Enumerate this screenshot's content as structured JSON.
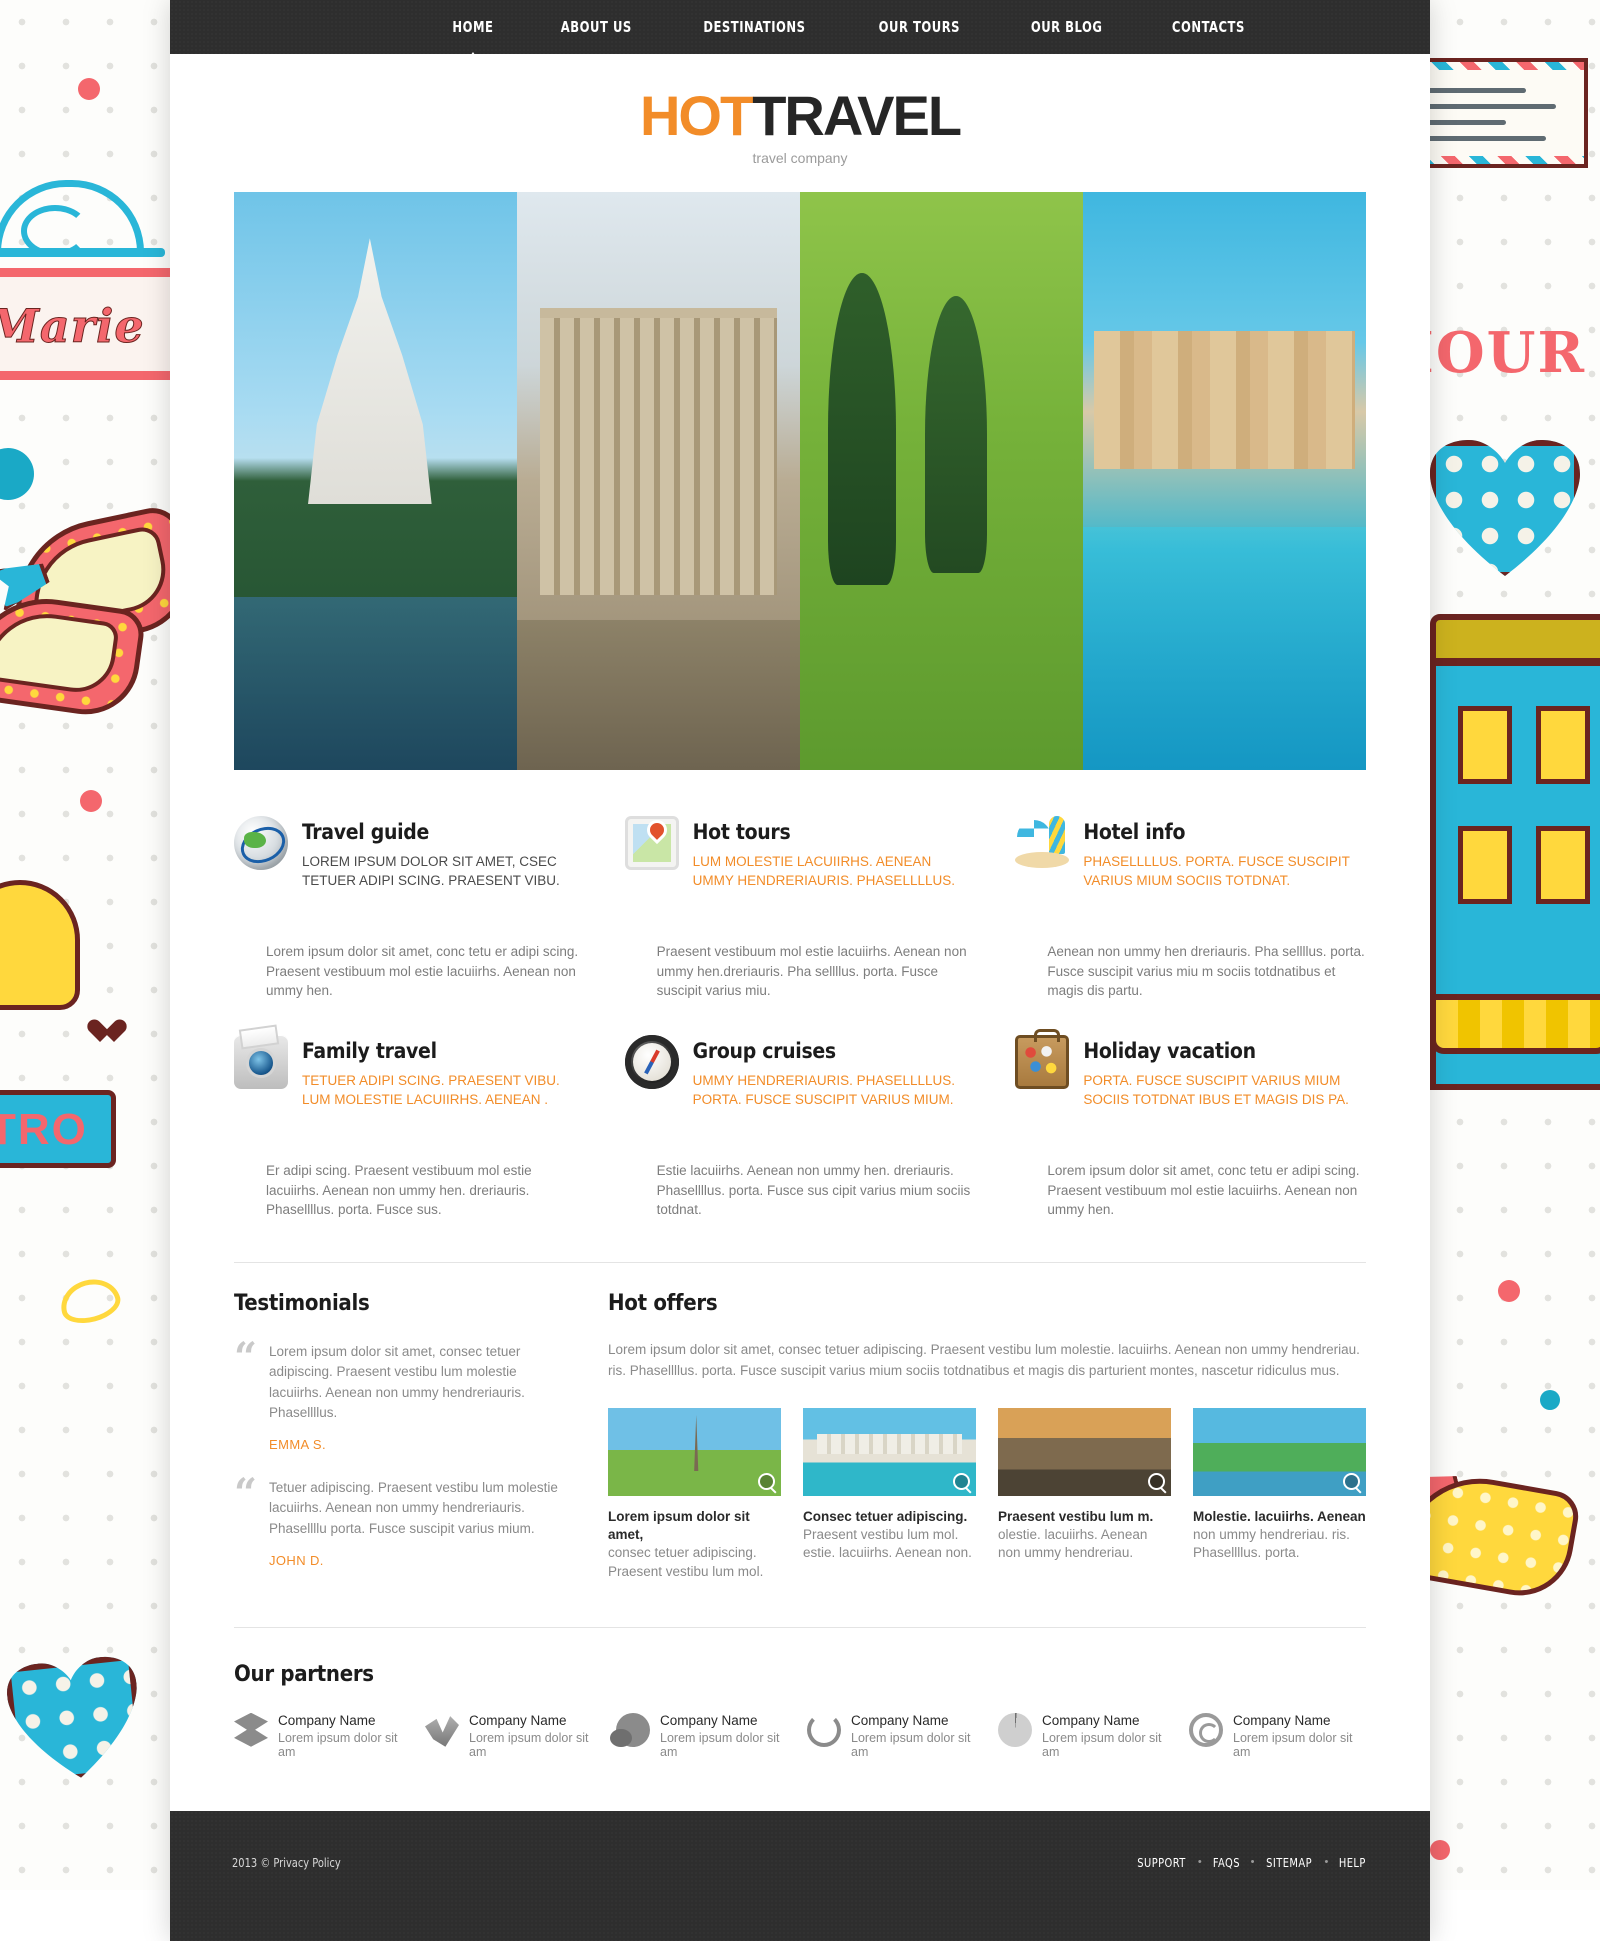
{
  "nav": {
    "items": [
      {
        "label": "HOME",
        "active": true
      },
      {
        "label": "ABOUT US",
        "active": false
      },
      {
        "label": "DESTINATIONS",
        "active": false
      },
      {
        "label": "OUR TOURS",
        "active": false
      },
      {
        "label": "OUR BLOG",
        "active": false
      },
      {
        "label": "CONTACTS",
        "active": false
      }
    ]
  },
  "logo": {
    "part1": "HOT",
    "part2": "TRAVEL",
    "tagline": "travel company",
    "accent_color": "#f28c28",
    "dark_color": "#262626"
  },
  "hero": {
    "panes": [
      {
        "alt": "thai-temple"
      },
      {
        "alt": "roman-ruins"
      },
      {
        "alt": "green-garden"
      },
      {
        "alt": "venice-canal"
      }
    ]
  },
  "services": [
    {
      "icon": "globe-icon",
      "title": "Travel guide",
      "subtitle": "LOREM IPSUM DOLOR SIT AMET, CSEC TETUER ADIPI SCING. PRAESENT VIBU.",
      "subtitle_orange": false,
      "text": "Lorem ipsum dolor sit amet, conc tetu er adipi scing. Praesent vestibuum mol estie lacuiirhs. Aenean non ummy hen."
    },
    {
      "icon": "map-pin-icon",
      "title": "Hot tours",
      "subtitle": "LUM MOLESTIE LACUIIRHS. AENEAN UMMY HENDRERIAURIS. PHASELLLLUS.",
      "subtitle_orange": true,
      "text": "Praesent vestibuum mol estie lacuiirhs. Aenean non ummy hen.dreriauris. Pha sellllus. porta. Fusce suscipit varius miu."
    },
    {
      "icon": "beach-umbrella-icon",
      "title": "Hotel info",
      "subtitle": "PHASELLLLUS. PORTA. FUSCE SUSCIPIT VARIUS MIUM SOCIIS TOTDNAT.",
      "subtitle_orange": true,
      "text": "Aenean non ummy hen dreriauris. Pha sellllus. porta. Fusce suscipit varius miu m sociis totdnatibus  et magis dis partu."
    },
    {
      "icon": "camera-icon",
      "title": "Family travel",
      "subtitle": "TETUER ADIPI SCING. PRAESENT VIBU. LUM MOLESTIE LACUIIRHS. AENEAN .",
      "subtitle_orange": true,
      "text": "Er adipi scing. Praesent vestibuum mol estie lacuiirhs. Aenean non ummy hen. dreriauris. Phasellllus. porta. Fusce sus."
    },
    {
      "icon": "compass-icon",
      "title": "Group cruises",
      "subtitle": "UMMY HENDRERIAURIS. PHASELLLLUS. PORTA. FUSCE SUSCIPIT VARIUS MIUM.",
      "subtitle_orange": true,
      "text": "Estie lacuiirhs. Aenean non ummy hen. dreriauris. Phasellllus. porta. Fusce sus cipit varius mium sociis totdnat."
    },
    {
      "icon": "suitcase-icon",
      "title": "Holiday vacation",
      "subtitle": "PORTA. FUSCE SUSCIPIT VARIUS MIUM SOCIIS TOTDNAT IBUS ET MAGIS DIS PA.",
      "subtitle_orange": true,
      "text": "Lorem ipsum dolor sit amet, conc tetu er adipi scing. Praesent vestibuum mol estie lacuiirhs. Aenean non ummy hen."
    }
  ],
  "testimonials": {
    "title": "Testimonials",
    "items": [
      {
        "text": "Lorem ipsum dolor sit amet, consec tetuer adipiscing. Praesent vestibu lum molestie lacuiirhs. Aenean non ummy  hendreriauris. Phasellllus.",
        "author": "EMMA S."
      },
      {
        "text": "Tetuer adipiscing. Praesent vestibu lum molestie lacuiirhs. Aenean non ummy  hendreriauris. Phasellllu porta. Fusce suscipit varius mium.",
        "author": "JOHN D."
      }
    ]
  },
  "hot_offers": {
    "title": "Hot offers",
    "intro": "Lorem ipsum dolor sit amet, consec tetuer adipiscing. Praesent vestibu lum molestie. lacuiirhs. Aenean non ummy hendreriau. ris. Phasellllus. porta. Fusce suscipit varius mium sociis totdnatibus et magis dis parturient montes, nascetur ridiculus mus.",
    "items": [
      {
        "thumb": "eiffel-tower-thumb",
        "title": "Lorem ipsum dolor sit amet,",
        "desc": "consec tetuer adipiscing. Praesent vestibu lum mol.",
        "zoom_icon": "magnifier-icon"
      },
      {
        "thumb": "beach-resort-thumb",
        "title": "Consec tetuer adipiscing.",
        "desc": "Praesent vestibu lum mol. estie. lacuiirhs. Aenean non.",
        "zoom_icon": "magnifier-icon"
      },
      {
        "thumb": "mountain-sunset-thumb",
        "title": "Praesent vestibu lum m.",
        "desc": "olestie. lacuiirhs. Aenean non ummy hendreriau.",
        "zoom_icon": "magnifier-icon"
      },
      {
        "thumb": "tropical-temple-thumb",
        "title": "Molestie. lacuiirhs. Aenean",
        "desc": "non ummy hendreriau. ris. Phasellllus. porta.",
        "zoom_icon": "magnifier-icon"
      }
    ]
  },
  "partners": {
    "title": "Our partners",
    "items": [
      {
        "icon": "diamond-logo-icon",
        "name": "Company Name",
        "desc": "Lorem ipsum dolor sit am"
      },
      {
        "icon": "ribbon-logo-icon",
        "name": "Company Name",
        "desc": "Lorem ipsum dolor sit am"
      },
      {
        "icon": "speech-bubble-logo-icon",
        "name": "Company Name",
        "desc": "Lorem ipsum dolor sit am"
      },
      {
        "icon": "swirl-circle-logo-icon",
        "name": "Company Name",
        "desc": "Lorem ipsum dolor sit am"
      },
      {
        "icon": "starburst-logo-icon",
        "name": "Company Name",
        "desc": "Lorem ipsum dolor sit am"
      },
      {
        "icon": "ring-logo-icon",
        "name": "Company Name",
        "desc": "Lorem ipsum dolor sit am"
      }
    ]
  },
  "footer": {
    "copyright": "2013 © Privacy Policy",
    "links": [
      "SUPPORT",
      "FAQS",
      "SITEMAP",
      "HELP"
    ],
    "separator": "•"
  },
  "background": {
    "sign_text": "Marie",
    "bistro_text": "TRO",
    "amour_text": "AMOUR"
  }
}
